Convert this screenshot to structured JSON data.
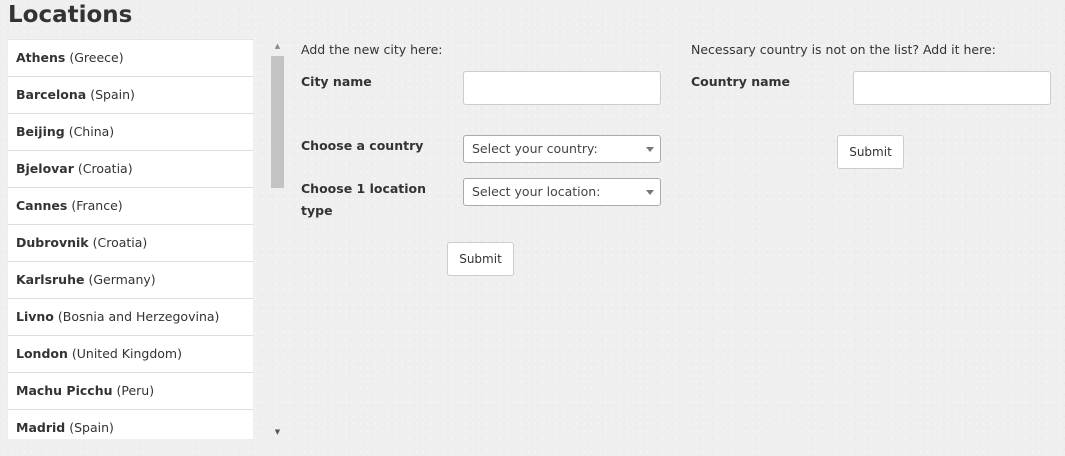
{
  "page_title": "Locations",
  "cities": [
    {
      "name": "Athens",
      "country": "(Greece)"
    },
    {
      "name": "Barcelona",
      "country": "(Spain)"
    },
    {
      "name": "Beijing",
      "country": "(China)"
    },
    {
      "name": "Bjelovar",
      "country": "(Croatia)"
    },
    {
      "name": "Cannes",
      "country": "(France)"
    },
    {
      "name": "Dubrovnik",
      "country": "(Croatia)"
    },
    {
      "name": "Karlsruhe",
      "country": "(Germany)"
    },
    {
      "name": "Livno",
      "country": "(Bosnia and Herzegovina)"
    },
    {
      "name": "London",
      "country": "(United Kingdom)"
    },
    {
      "name": "Machu Picchu",
      "country": "(Peru)"
    },
    {
      "name": "Madrid",
      "country": "(Spain)"
    }
  ],
  "city_form": {
    "heading": "Add the new city here:",
    "city_name_label": "City name",
    "city_name_value": "",
    "country_label": "Choose a country",
    "country_select": "Select your country:",
    "location_type_label": "Choose 1 location type",
    "location_select": "Select your location:",
    "submit_label": "Submit"
  },
  "country_form": {
    "heading": "Necessary country is not on the list? Add it here:",
    "country_name_label": "Country name",
    "country_name_value": "",
    "submit_label": "Submit"
  },
  "icons": {
    "scroll_up": "triangle-up",
    "scroll_down": "triangle-down",
    "select_arrow": "chevron-down"
  }
}
